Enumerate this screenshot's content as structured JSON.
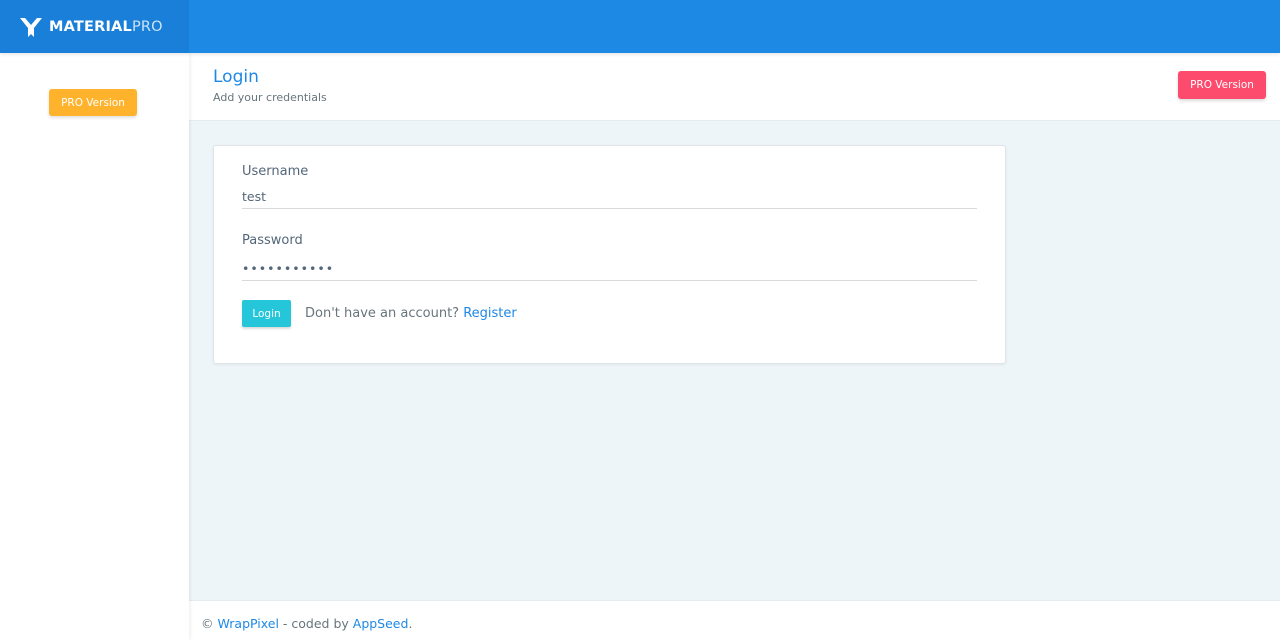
{
  "brand": {
    "name_strong": "MATERIAL",
    "name_light": "PRO",
    "logo_icon": "materialpro-logo-icon"
  },
  "colors": {
    "topbar": "#1e88e5",
    "sidebar_badge": "#ffb22b",
    "header_badge": "#fc4b6c",
    "login_button": "#26c6da",
    "link": "#1e88e5"
  },
  "sidebar": {
    "pro_label": "PRO Version"
  },
  "header": {
    "title": "Login",
    "subtitle": "Add your credentials",
    "pro_label": "PRO Version"
  },
  "form": {
    "username_label": "Username",
    "username_value": "test",
    "password_label": "Password",
    "password_value": "•••••••••••",
    "login_label": "Login",
    "register_prompt": "Don't have an account?",
    "register_link": "Register"
  },
  "footer": {
    "copyright": "©",
    "link1": "WrapPixel",
    "middle": " - coded by ",
    "link2": "AppSeed",
    "end": "."
  }
}
